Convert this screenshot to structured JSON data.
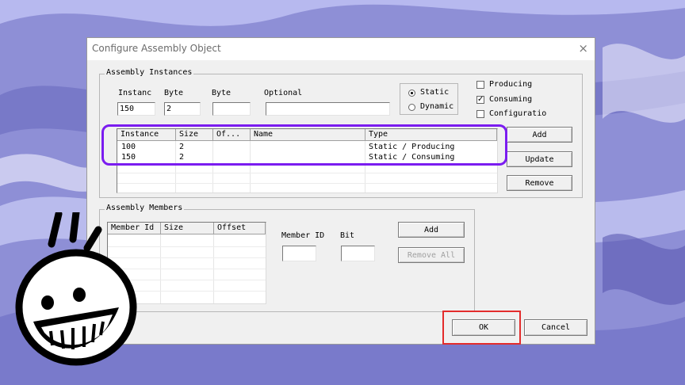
{
  "colors": {
    "highlight_purple": "#7b1cf0",
    "highlight_red": "#e32c2c",
    "background": "#8e8fd6"
  },
  "dialog": {
    "title": "Configure Assembly Object",
    "close_icon": "×",
    "assembly_instances": {
      "group_label": "Assembly Instances",
      "instance_label": "Instanc",
      "byte_label_1": "Byte",
      "byte_label_2": "Byte",
      "optional_label": "Optional",
      "instance_value": "150",
      "byte_value": "2",
      "byte_value_2": "",
      "optional_value": "",
      "radio_static": "Static",
      "radio_dynamic": "Dynamic",
      "check_producing": "Producing",
      "check_consuming": "Consuming",
      "check_configuration": "Configuratio",
      "consuming_check_mark": "✓",
      "table_headers": [
        "Instance",
        "Size",
        "Of...",
        "Name",
        "Type"
      ],
      "rows": [
        {
          "instance": "100",
          "size": "2",
          "offset": "",
          "name": "",
          "type": "Static / Producing"
        },
        {
          "instance": "150",
          "size": "2",
          "offset": "",
          "name": "",
          "type": "Static / Consuming"
        }
      ],
      "add_button": "Add",
      "update_button": "Update",
      "remove_button": "Remove"
    },
    "assembly_members": {
      "group_label": "Assembly Members",
      "table_headers": [
        "Member Id",
        "Size",
        "Offset"
      ],
      "member_id_label": "Member ID",
      "bit_label": "Bit",
      "member_id_value": "",
      "bit_value": "",
      "add_button": "Add",
      "remove_all_button": "Remove All"
    },
    "ok_button": "OK",
    "cancel_button": "Cancel"
  }
}
